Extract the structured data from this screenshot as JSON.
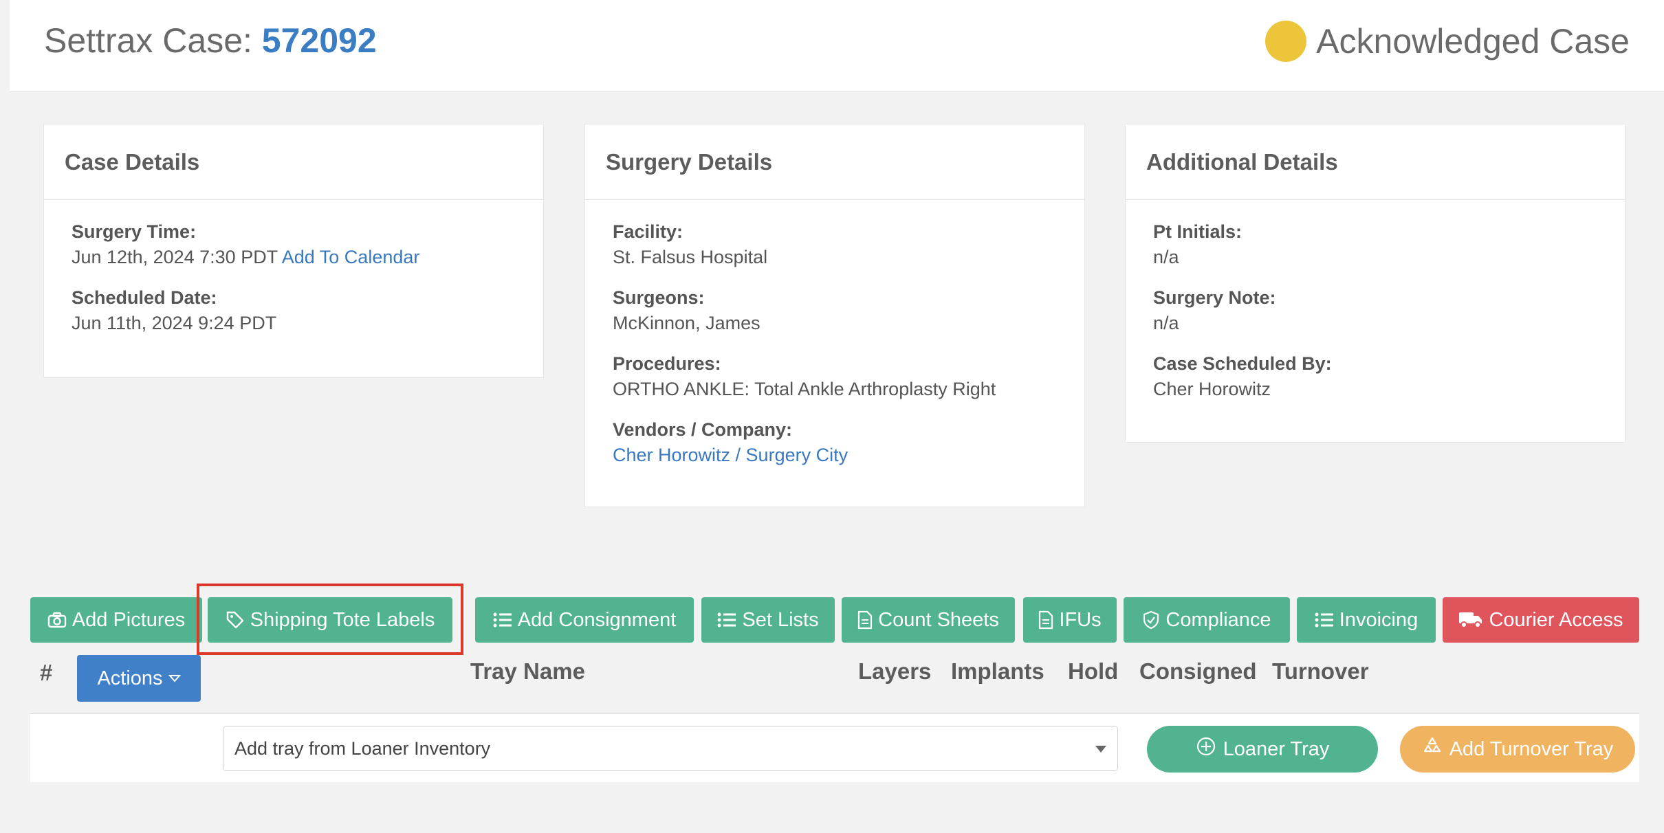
{
  "header": {
    "case_prefix": "Settrax Case: ",
    "case_number": "572092",
    "status": "Acknowledged Case",
    "status_color": "#ecc53a"
  },
  "case_details": {
    "title": "Case Details",
    "surgery_time_label": "Surgery Time:",
    "surgery_time_value": "Jun 12th, 2024 7:30 PDT",
    "add_to_calendar": "Add To Calendar",
    "scheduled_date_label": "Scheduled Date:",
    "scheduled_date_value": "Jun 11th, 2024 9:24 PDT"
  },
  "surgery_details": {
    "title": "Surgery Details",
    "facility_label": "Facility:",
    "facility_value": "St. Falsus Hospital",
    "surgeons_label": "Surgeons:",
    "surgeons_value": "McKinnon, James",
    "procedures_label": "Procedures:",
    "procedures_value": "ORTHO ANKLE: Total Ankle Arthroplasty Right",
    "vendors_label": "Vendors / Company:",
    "vendors_value": "Cher Horowitz / Surgery City"
  },
  "additional_details": {
    "title": "Additional Details",
    "pt_initials_label": "Pt Initials:",
    "pt_initials_value": "n/a",
    "surgery_note_label": "Surgery Note:",
    "surgery_note_value": "n/a",
    "scheduled_by_label": "Case Scheduled By:",
    "scheduled_by_value": "Cher Horowitz"
  },
  "toolbar": {
    "add_pictures": "Add Pictures",
    "shipping_tote_labels": "Shipping Tote Labels",
    "add_consignment": "Add Consignment",
    "set_lists": "Set Lists",
    "count_sheets": "Count Sheets",
    "ifus": "IFUs",
    "compliance": "Compliance",
    "invoicing": "Invoicing",
    "courier_access": "Courier Access"
  },
  "table": {
    "hash": "#",
    "actions": "Actions",
    "columns": [
      "Tray Name",
      "Layers",
      "Implants",
      "Hold",
      "Consigned",
      "Turnover"
    ]
  },
  "tray_row": {
    "select_value": "Add tray from Loaner Inventory",
    "loaner_tray": "Loaner Tray",
    "add_turnover_tray": "Add Turnover Tray"
  },
  "colors": {
    "green": "#52b391",
    "red": "#e0545c",
    "blue": "#3f80c8",
    "orange": "#f0b461",
    "link": "#3a78bd"
  }
}
